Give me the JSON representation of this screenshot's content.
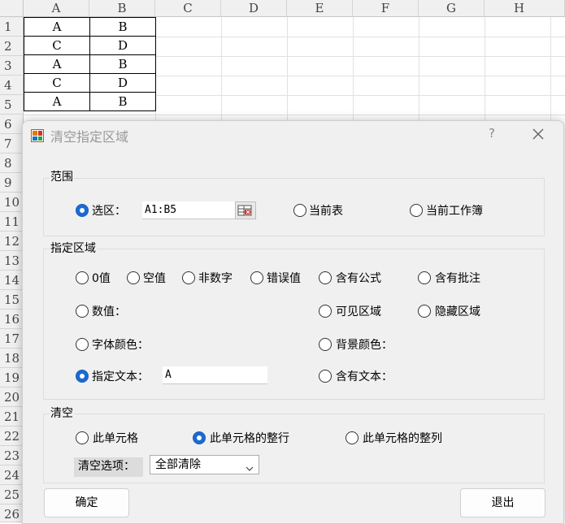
{
  "spreadsheet": {
    "columns": [
      "A",
      "B",
      "C",
      "D",
      "E",
      "F",
      "G",
      "H"
    ],
    "rows": [
      "1",
      "2",
      "3",
      "4",
      "5",
      "6",
      "7",
      "8",
      "9",
      "10",
      "11",
      "12",
      "13",
      "14",
      "15",
      "16",
      "17",
      "18",
      "19",
      "20",
      "21",
      "22",
      "23",
      "24",
      "25",
      "26"
    ],
    "cells": [
      {
        "a": "A",
        "b": "B"
      },
      {
        "a": "C",
        "b": "D"
      },
      {
        "a": "A",
        "b": "B"
      },
      {
        "a": "C",
        "b": "D"
      },
      {
        "a": "A",
        "b": "B"
      }
    ]
  },
  "dialog": {
    "title": "清空指定区域",
    "help": "?",
    "range_group": {
      "label": "范围",
      "selection_label": "选区：",
      "selection_value": "A1:B5",
      "current_sheet": "当前表",
      "current_workbook": "当前工作簿",
      "selected": "selection"
    },
    "area_group": {
      "label": "指定区域",
      "options": {
        "zero": "0值",
        "empty": "空值",
        "non_numeric": "非数字",
        "error": "错误值",
        "formula": "含有公式",
        "comment": "含有批注",
        "numeric": "数值：",
        "visible": "可见区域",
        "hidden": "隐藏区域",
        "font_color": "字体颜色：",
        "bg_color": "背景颜色：",
        "specified_text": "指定文本：",
        "contains_text": "含有文本："
      },
      "specified_text_value": "A",
      "selected": "specified_text"
    },
    "clear_group": {
      "label": "清空",
      "this_cell": "此单元格",
      "entire_row": "此单元格的整行",
      "entire_col": "此单元格的整列",
      "selected": "entire_row",
      "options_label": "清空选项：",
      "options_value": "全部清除"
    },
    "ok": "确定",
    "exit": "退出"
  },
  "colors": {
    "radio_selected": "#1a6ad4",
    "dialog_bg": "#f0f0f0"
  }
}
